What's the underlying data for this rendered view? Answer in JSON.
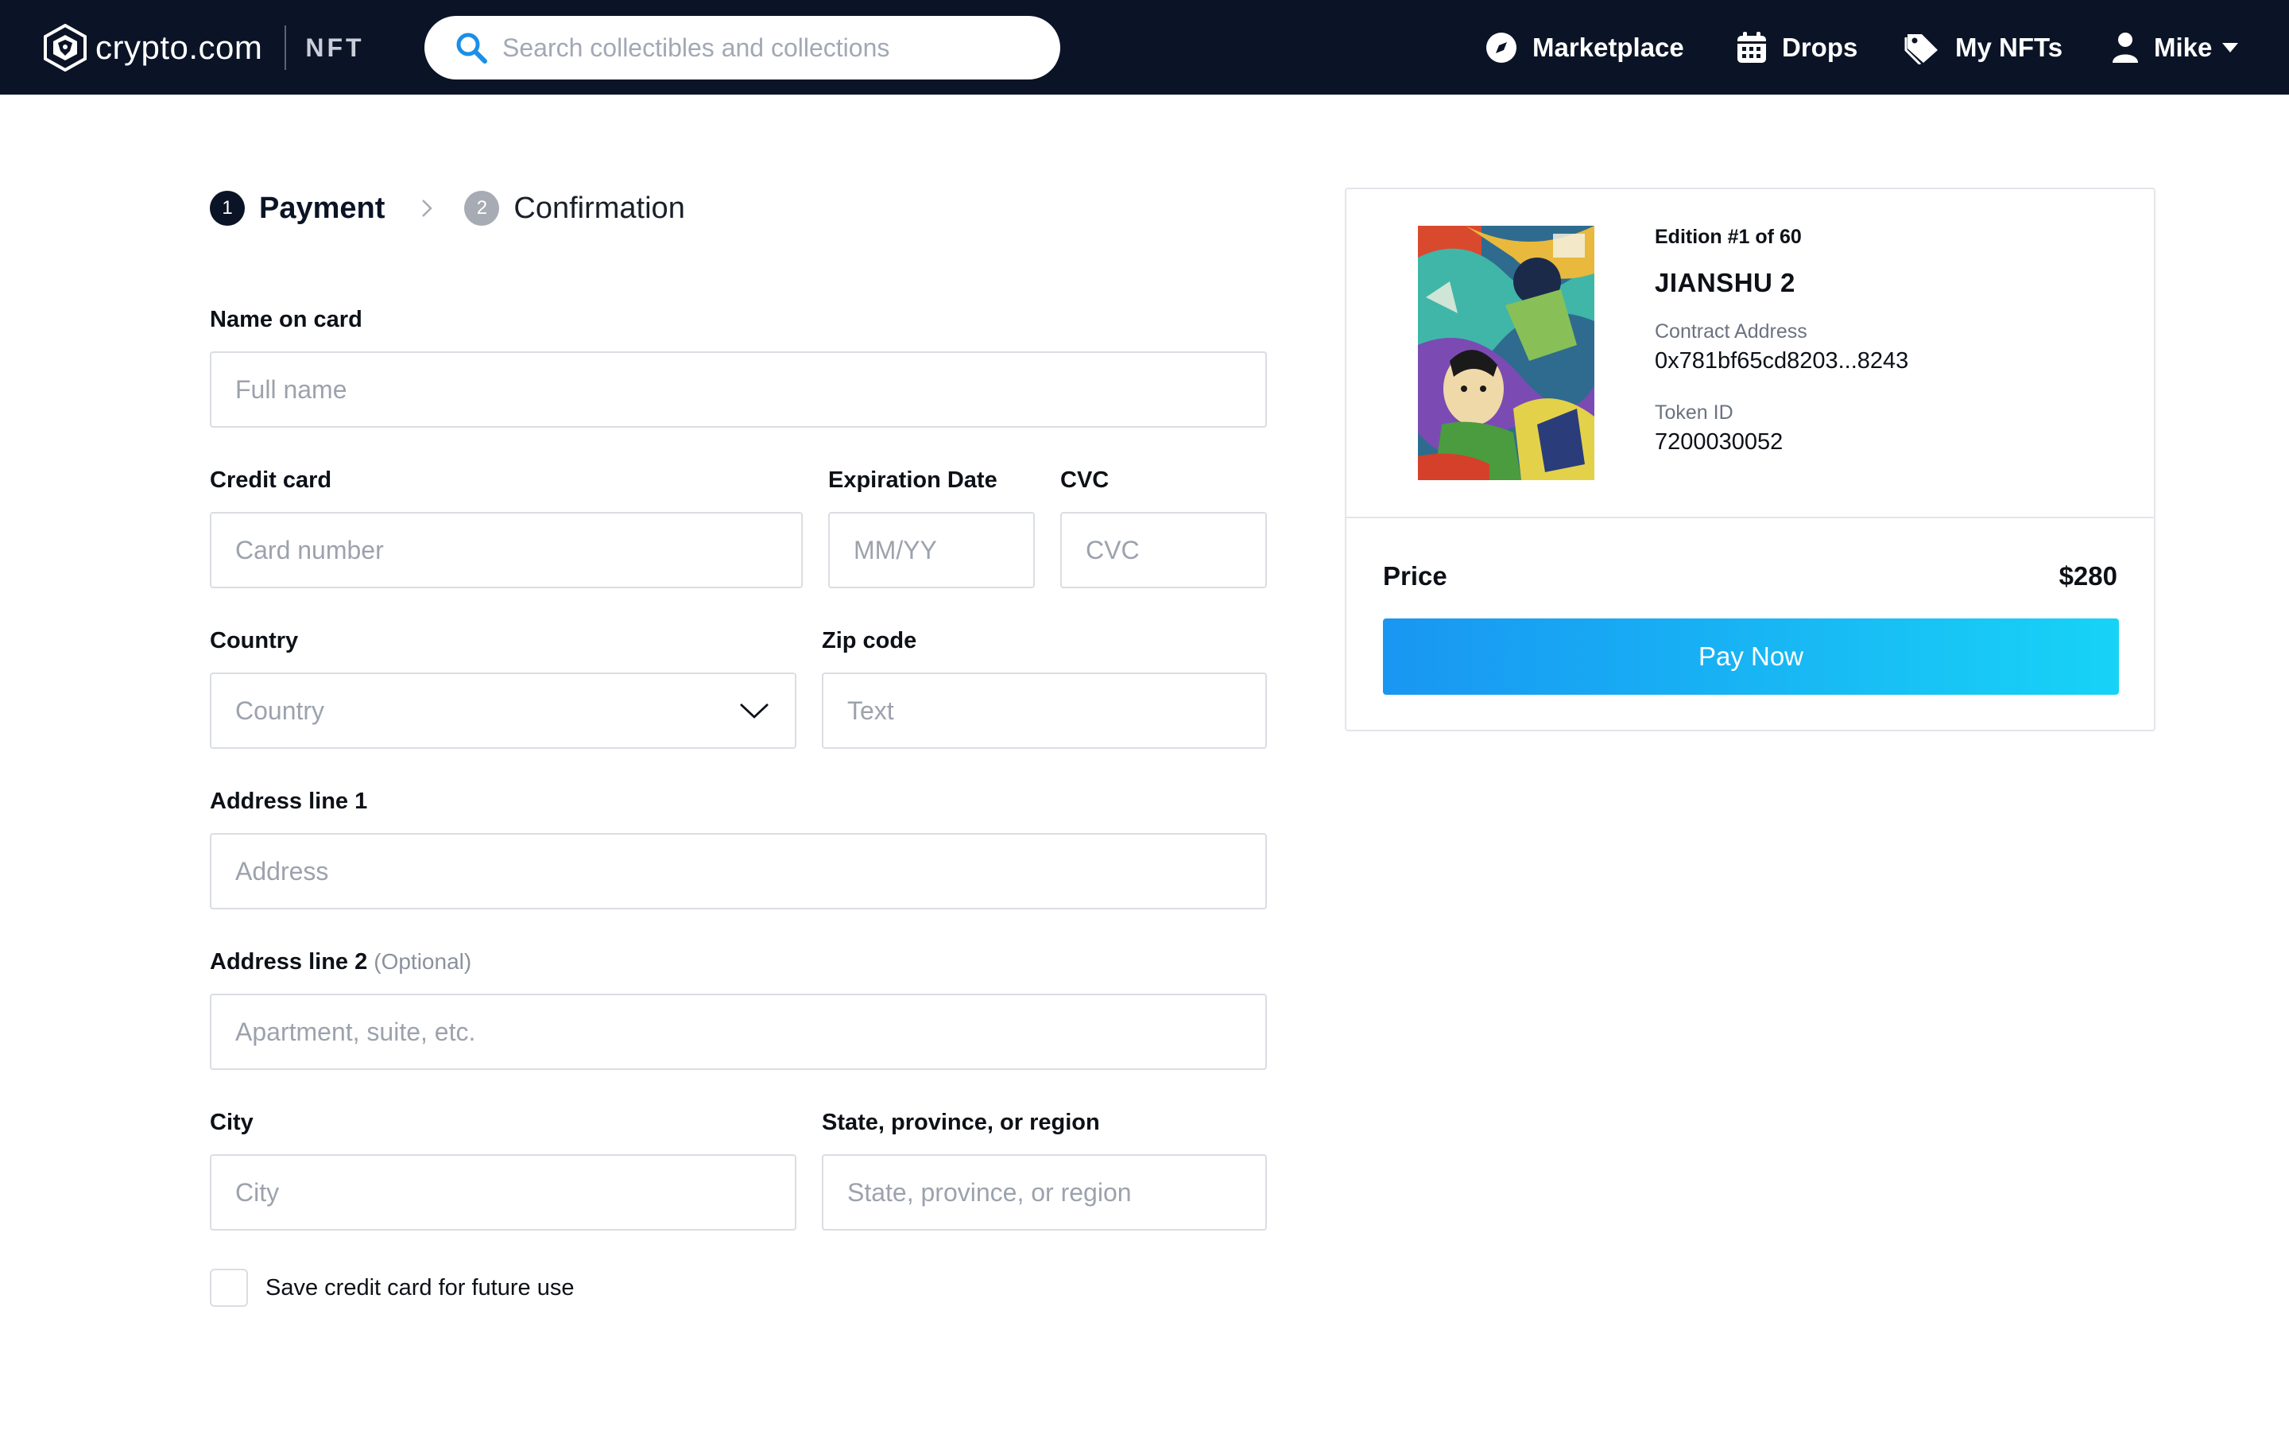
{
  "header": {
    "logo_text": "crypto.com",
    "logo_suffix": "NFT",
    "search_placeholder": "Search collectibles and collections",
    "nav": {
      "marketplace": "Marketplace",
      "drops": "Drops",
      "my_nfts": "My NFTs",
      "user": "Mike"
    }
  },
  "stepper": {
    "step1": {
      "number": "1",
      "label": "Payment"
    },
    "step2": {
      "number": "2",
      "label": "Confirmation"
    }
  },
  "form": {
    "name_on_card": {
      "label": "Name on card",
      "placeholder": "Full name"
    },
    "credit_card": {
      "label": "Credit card",
      "placeholder": "Card number"
    },
    "expiration": {
      "label": "Expiration Date",
      "placeholder": "MM/YY"
    },
    "cvc": {
      "label": "CVC",
      "placeholder": "CVC"
    },
    "country": {
      "label": "Country",
      "value": "Country"
    },
    "zip": {
      "label": "Zip code",
      "placeholder": "Text"
    },
    "address1": {
      "label": "Address line 1",
      "placeholder": "Address"
    },
    "address2": {
      "label": "Address line 2",
      "optional": "(Optional)",
      "placeholder": "Apartment, suite, etc."
    },
    "city": {
      "label": "City",
      "placeholder": "City"
    },
    "state": {
      "label": "State, province, or region",
      "placeholder": "State, province, or region"
    },
    "save_card": {
      "label": "Save credit card for future use",
      "checked": false
    }
  },
  "order": {
    "edition": "Edition #1 of 60",
    "title": "JIANSHU 2",
    "contract_label": "Contract Address",
    "contract_value": "0x781bf65cd8203...8243",
    "token_label": "Token ID",
    "token_value": "7200030052",
    "price_label": "Price",
    "price_value": "$280",
    "pay_button": "Pay Now"
  },
  "colors": {
    "topbar": "#0b1426",
    "accent_start": "#1996f2",
    "accent_end": "#17d3f6",
    "search_icon": "#1a8fe6"
  },
  "icons": [
    "crypto-logo-icon",
    "search-icon",
    "compass-icon",
    "calendar-icon",
    "tags-icon",
    "user-icon",
    "caret-down-icon",
    "chevron-right-icon",
    "chevron-down-icon"
  ]
}
